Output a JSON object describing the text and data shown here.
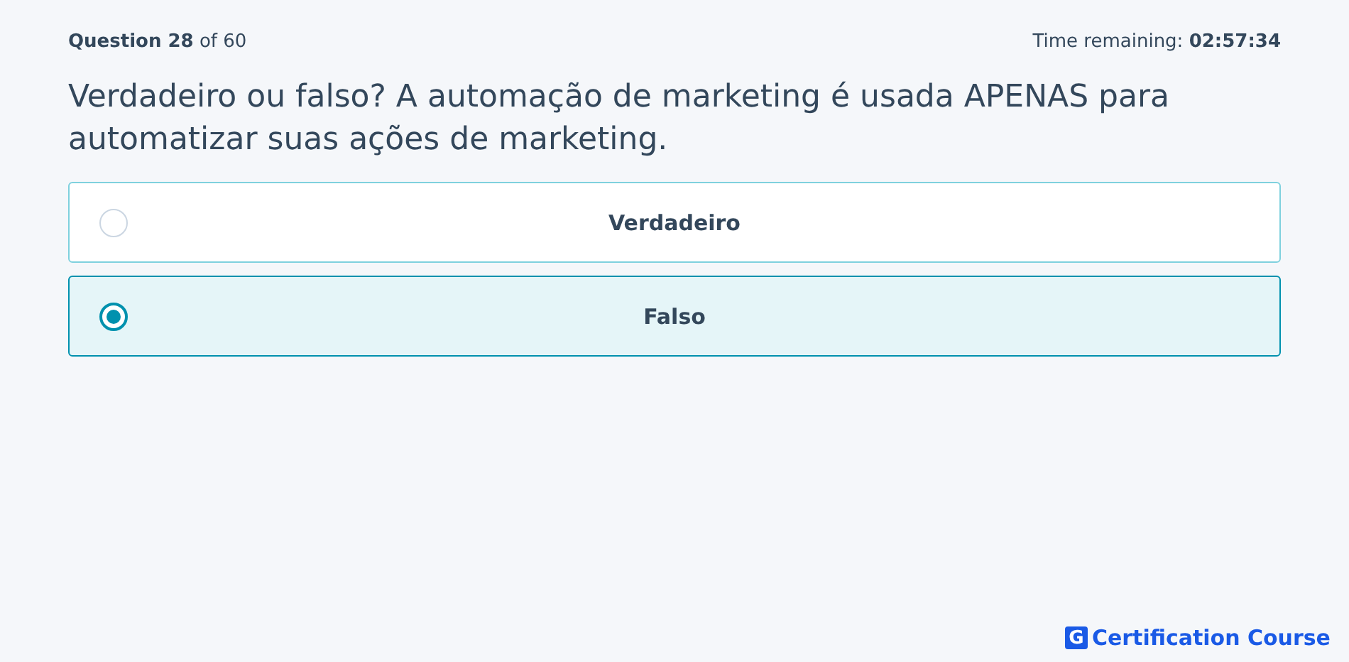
{
  "header": {
    "progress": "**Question 28** of 60",
    "timer": "Time remaining: **02:57:34**"
  },
  "question": "Verdadeiro ou falso? A automação de marketing é usada APENAS para automatizar suas ações de marketing.",
  "options": [
    {
      "label": "Verdadeiro",
      "selected": false
    },
    {
      "label": "Falso",
      "selected": true
    }
  ],
  "brand": {
    "mark": "G",
    "name": "Certification Course"
  }
}
